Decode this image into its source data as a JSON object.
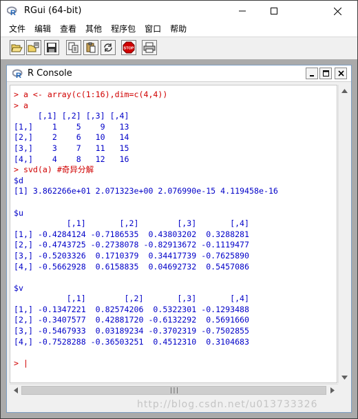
{
  "window": {
    "title": "RGui (64-bit)"
  },
  "menu": [
    "文件",
    "编辑",
    "查看",
    "其他",
    "程序包",
    "窗口",
    "帮助"
  ],
  "toolbar": {
    "buttons": [
      "open-script-icon",
      "load-workspace-icon",
      "save-icon",
      "copy-icon",
      "paste-icon",
      "copy-paste-icon",
      "stop-icon",
      "print-icon"
    ],
    "stop_label": "STOP"
  },
  "console_window": {
    "title": "R Console"
  },
  "console": {
    "lines": [
      {
        "type": "in",
        "text": "> a <- array(c(1:16),dim=c(4,4))"
      },
      {
        "type": "in",
        "text": "> a"
      },
      {
        "type": "out",
        "text": "     [,1] [,2] [,3] [,4]"
      },
      {
        "type": "out",
        "text": "[1,]    1    5    9   13"
      },
      {
        "type": "out",
        "text": "[2,]    2    6   10   14"
      },
      {
        "type": "out",
        "text": "[3,]    3    7   11   15"
      },
      {
        "type": "out",
        "text": "[4,]    4    8   12   16"
      },
      {
        "type": "in",
        "text": "> svd(a) #奇异分解"
      },
      {
        "type": "out",
        "text": "$d"
      },
      {
        "type": "out",
        "text": "[1] 3.862266e+01 2.071323e+00 2.076990e-15 4.119458e-16"
      },
      {
        "type": "out",
        "text": ""
      },
      {
        "type": "out",
        "text": "$u"
      },
      {
        "type": "out",
        "text": "           [,1]       [,2]        [,3]       [,4]"
      },
      {
        "type": "out",
        "text": "[1,] -0.4284124 -0.7186535  0.43803202  0.3288281"
      },
      {
        "type": "out",
        "text": "[2,] -0.4743725 -0.2738078 -0.82913672 -0.1119477"
      },
      {
        "type": "out",
        "text": "[3,] -0.5203326  0.1710379  0.34417739 -0.7625890"
      },
      {
        "type": "out",
        "text": "[4,] -0.5662928  0.6158835  0.04692732  0.5457086"
      },
      {
        "type": "out",
        "text": ""
      },
      {
        "type": "out",
        "text": "$v"
      },
      {
        "type": "out",
        "text": "           [,1]        [,2]       [,3]       [,4]"
      },
      {
        "type": "out",
        "text": "[1,] -0.1347221  0.82574206  0.5322301 -0.1293488"
      },
      {
        "type": "out",
        "text": "[2,] -0.3407577  0.42881720 -0.6132292  0.5691660"
      },
      {
        "type": "out",
        "text": "[3,] -0.5467933  0.03189234 -0.3702319 -0.7502855"
      },
      {
        "type": "out",
        "text": "[4,] -0.7528288 -0.36503251  0.4512310  0.3104683"
      },
      {
        "type": "out",
        "text": ""
      },
      {
        "type": "in",
        "text": "> |"
      }
    ]
  },
  "watermark": "http://blog.csdn.net/u013733326",
  "colors": {
    "input": "#d00000",
    "output": "#0000c8",
    "mdi_background": "#aaaaaa"
  }
}
